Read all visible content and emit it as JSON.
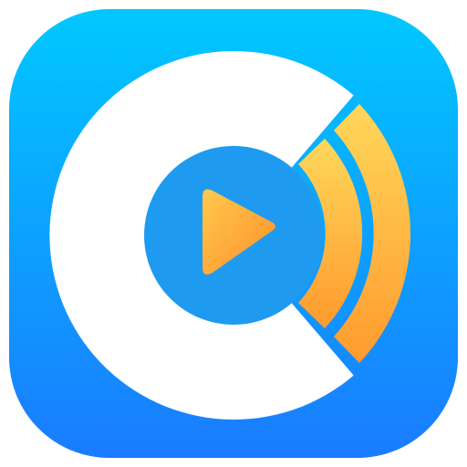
{
  "icon": {
    "name": "media-cast-app-icon",
    "colors": {
      "background_top": "#00C8FF",
      "background_bottom": "#1A7BFF",
      "disc": "#FFFFFF",
      "disc_center": "#1E9BF0",
      "accent_top": "#FFD75A",
      "accent_bottom": "#FF9A2E"
    }
  }
}
